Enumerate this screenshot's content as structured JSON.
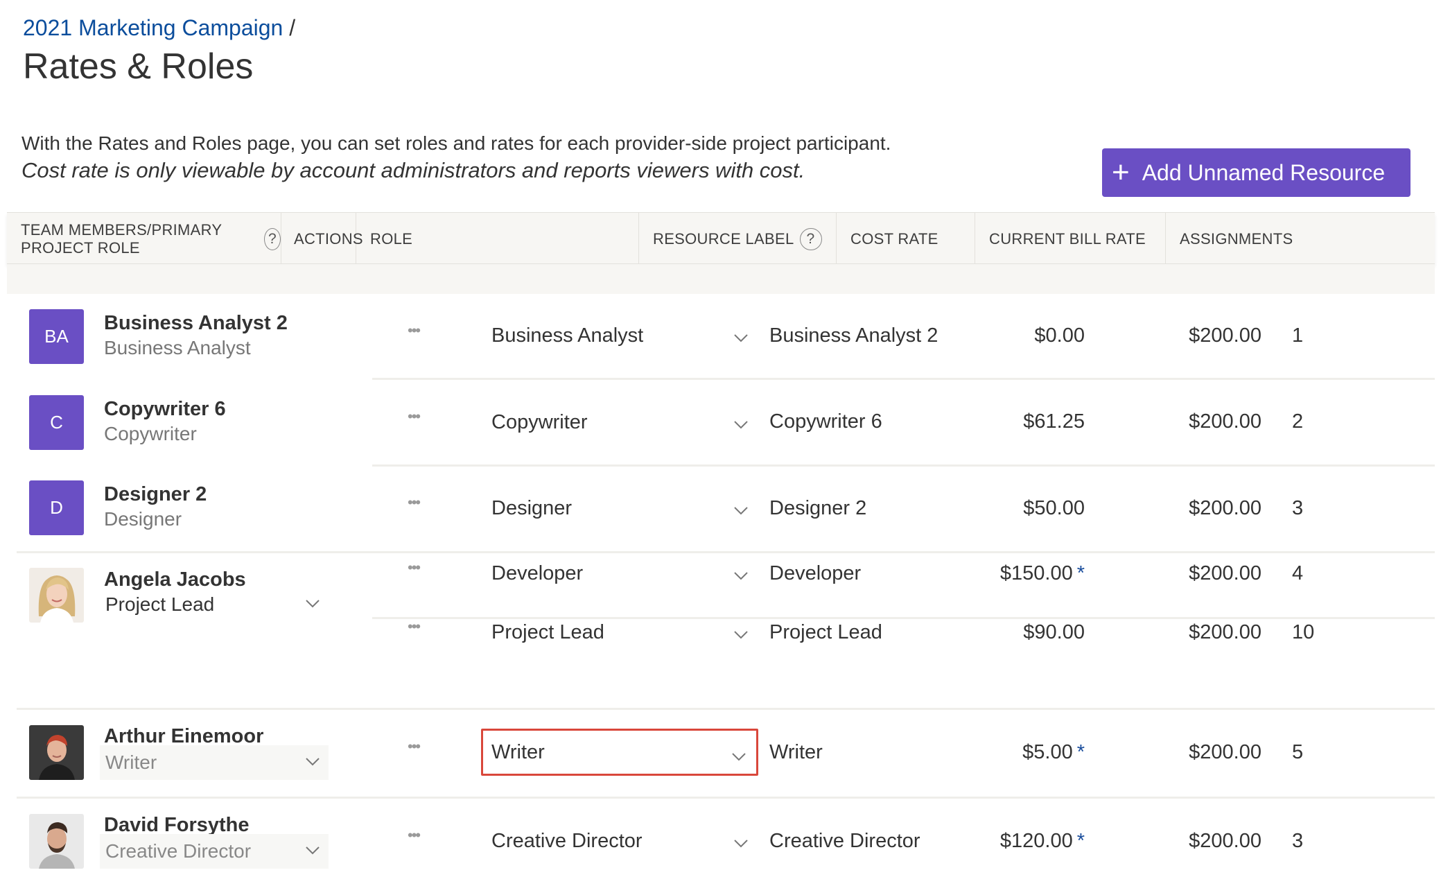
{
  "breadcrumb": {
    "parent": "2021 Marketing Campaign",
    "separator": "/"
  },
  "page": {
    "title": "Rates & Roles",
    "description": "With the Rates and Roles page, you can set roles and rates for each provider-side project participant.",
    "note": "Cost rate is only viewable by account administrators and reports viewers with cost."
  },
  "add_button": {
    "icon": "plus-icon",
    "label": "Add Unnamed Resource"
  },
  "columns": {
    "team": "TEAM MEMBERS/PRIMARY PROJECT ROLE",
    "actions": "ACTIONS",
    "role": "ROLE",
    "resource_label": "RESOURCE LABEL",
    "cost_rate": "COST RATE",
    "bill_rate": "CURRENT BILL RATE",
    "assignments": "ASSIGNMENTS",
    "help": "?"
  },
  "colors": {
    "accent": "#6a4fc4",
    "link": "#0b4d9c",
    "highlight_border": "#d9473b",
    "star": "#1a4d9c"
  },
  "actions_glyph": "•••",
  "members": [
    {
      "initials": "BA",
      "name": "Business Analyst 2",
      "primary_role": "Business Analyst",
      "rows": [
        {
          "role": "Business Analyst",
          "label": "Business Analyst 2",
          "cost": "$0.00",
          "star": "",
          "bill": "$200.00",
          "assignments": "1"
        }
      ]
    },
    {
      "initials": "C",
      "name": "Copywriter 6",
      "primary_role": "Copywriter",
      "rows": [
        {
          "role": "Copywriter",
          "label": "Copywriter 6",
          "cost": "$61.25",
          "star": "",
          "bill": "$200.00",
          "assignments": "2"
        }
      ]
    },
    {
      "initials": "D",
      "name": "Designer 2",
      "primary_role": "Designer",
      "rows": [
        {
          "role": "Designer",
          "label": "Designer 2",
          "cost": "$50.00",
          "star": "",
          "bill": "$200.00",
          "assignments": "3"
        }
      ]
    },
    {
      "photo": "angela-photo",
      "name": "Angela Jacobs",
      "primary_role": "Project Lead",
      "rows": [
        {
          "role": "Developer",
          "label": "Developer",
          "cost": "$150.00",
          "star": "*",
          "bill": "$200.00",
          "assignments": "4"
        },
        {
          "role": "Project Lead",
          "label": "Project Lead",
          "cost": "$90.00",
          "star": "",
          "bill": "$200.00",
          "assignments": "10"
        }
      ]
    },
    {
      "photo": "arthur-photo",
      "name": "Arthur Einemoor",
      "primary_role": "Writer",
      "rows": [
        {
          "role": "Writer",
          "label": "Writer",
          "cost": "$5.00",
          "star": "*",
          "bill": "$200.00",
          "assignments": "5"
        }
      ]
    },
    {
      "photo": "david-photo",
      "name": "David Forsythe",
      "primary_role": "Creative Director",
      "rows": [
        {
          "role": "Creative Director",
          "label": "Creative Director",
          "cost": "$120.00",
          "star": "*",
          "bill": "$200.00",
          "assignments": "3"
        }
      ]
    }
  ]
}
